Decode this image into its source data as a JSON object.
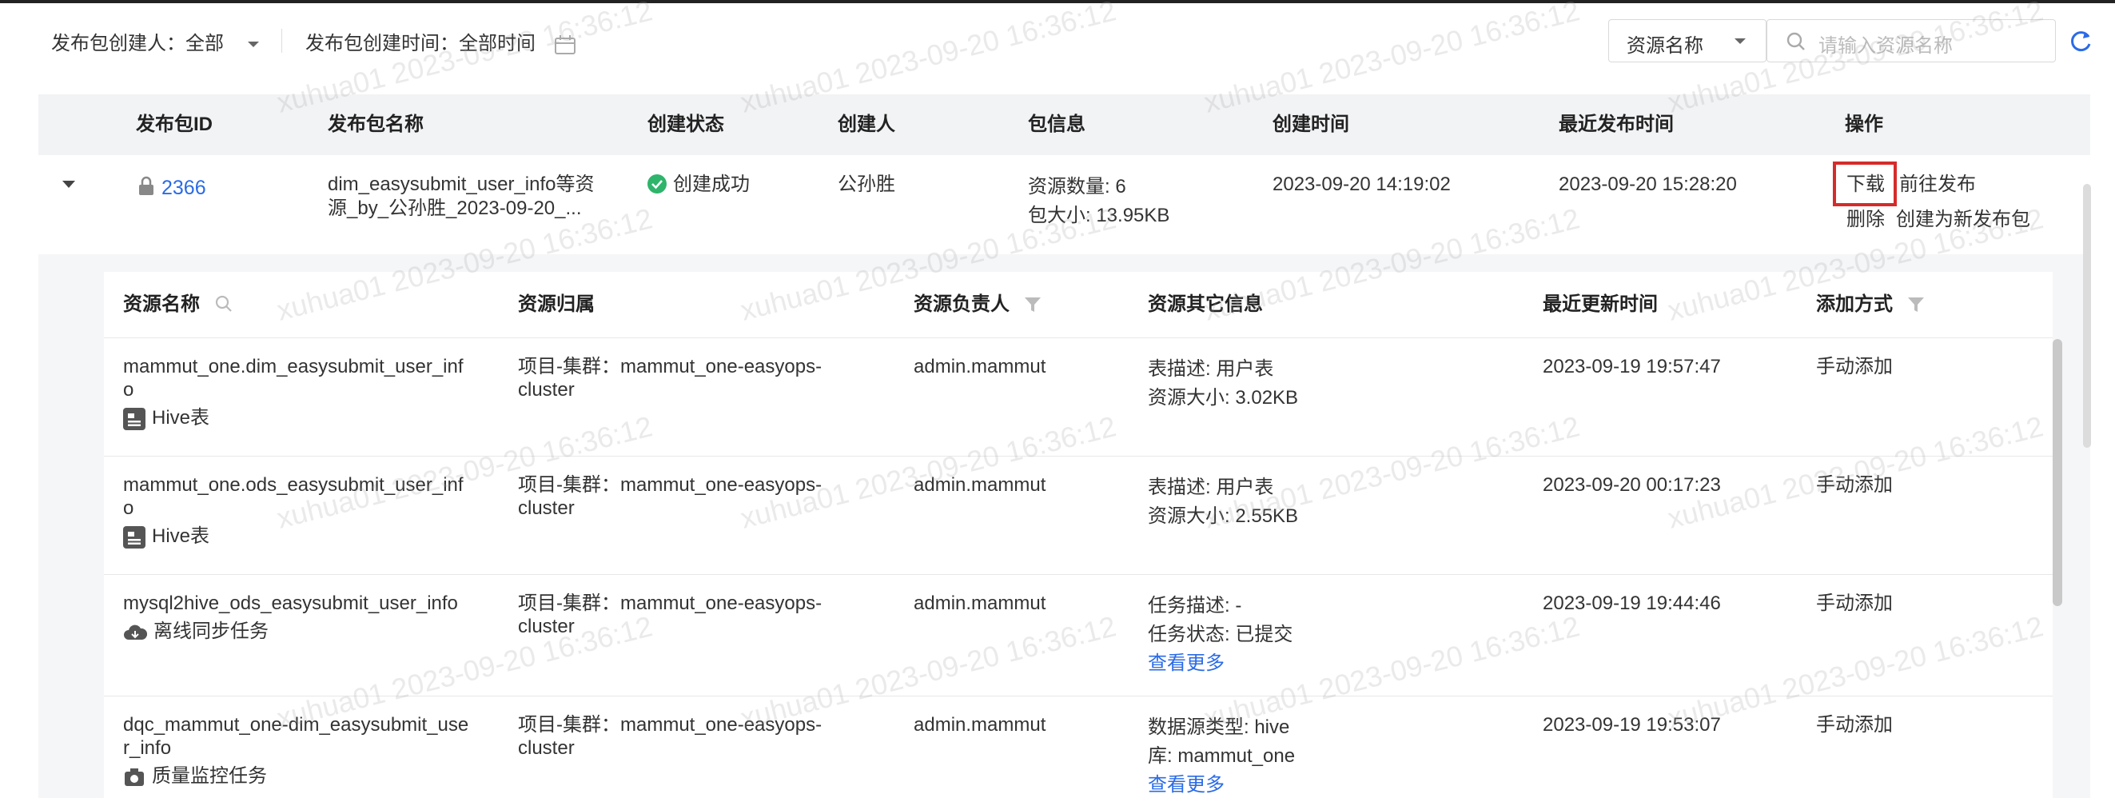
{
  "filters": {
    "creator_label": "发布包创建人：",
    "creator_value": "全部",
    "time_label": "发布包创建时间：",
    "time_value": "全部时间",
    "search_type": "资源名称",
    "search_placeholder": "请输入资源名称"
  },
  "table": {
    "headers": [
      "发布包ID",
      "发布包名称",
      "创建状态",
      "创建人",
      "包信息",
      "创建时间",
      "最近发布时间",
      "操作"
    ],
    "row": {
      "id": "2366",
      "name_line1": "dim_easysubmit_user_info等资",
      "name_line2": "源_by_公孙胜_2023-09-20_...",
      "status": "创建成功",
      "creator": "公孙胜",
      "info_line1": "资源数量: 6",
      "info_line2": "包大小: 13.95KB",
      "created_at": "2023-09-20 14:19:02",
      "published_at": "2023-09-20 15:28:20",
      "actions": {
        "download": "下载",
        "goto_publish": "前往发布",
        "delete": "删除",
        "create_new": "创建为新发布包"
      }
    }
  },
  "resources": {
    "headers": [
      "资源名称",
      "资源归属",
      "资源负责人",
      "资源其它信息",
      "最近更新时间",
      "添加方式"
    ],
    "rows": [
      {
        "name_l1": "mammut_one.dim_easysubmit_user_inf",
        "name_l2": "o",
        "type": "Hive表",
        "type_icon": "table-icon",
        "owner_l1": "项目-集群：mammut_one-easyops-",
        "owner_l2": "cluster",
        "person": "admin.mammut",
        "info_l1": "表描述: 用户表",
        "info_l2": "资源大小: 3.02KB",
        "info_l3": "",
        "updated": "2023-09-19 19:57:47",
        "method": "手动添加"
      },
      {
        "name_l1": "mammut_one.ods_easysubmit_user_inf",
        "name_l2": "o",
        "type": "Hive表",
        "type_icon": "table-icon",
        "owner_l1": "项目-集群：mammut_one-easyops-",
        "owner_l2": "cluster",
        "person": "admin.mammut",
        "info_l1": "表描述: 用户表",
        "info_l2": "资源大小: 2.55KB",
        "info_l3": "",
        "updated": "2023-09-20 00:17:23",
        "method": "手动添加"
      },
      {
        "name_l1": "mysql2hive_ods_easysubmit_user_info",
        "name_l2": "",
        "type": "离线同步任务",
        "type_icon": "cloud-icon",
        "owner_l1": "项目-集群：mammut_one-easyops-",
        "owner_l2": "cluster",
        "person": "admin.mammut",
        "info_l1": "任务描述: -",
        "info_l2": "任务状态: 已提交",
        "info_l3": "查看更多",
        "updated": "2023-09-19 19:44:46",
        "method": "手动添加"
      },
      {
        "name_l1": "dqc_mammut_one-dim_easysubmit_use",
        "name_l2": "r_info",
        "type": "质量监控任务",
        "type_icon": "camera-icon",
        "owner_l1": "项目-集群：mammut_one-easyops-",
        "owner_l2": "cluster",
        "person": "admin.mammut",
        "info_l1": "数据源类型: hive",
        "info_l2": "库: mammut_one",
        "info_l3": "查看更多",
        "updated": "2023-09-19 19:53:07",
        "method": "手动添加"
      }
    ]
  },
  "watermark": "xuhua01 2023-09-20 16:36:12"
}
